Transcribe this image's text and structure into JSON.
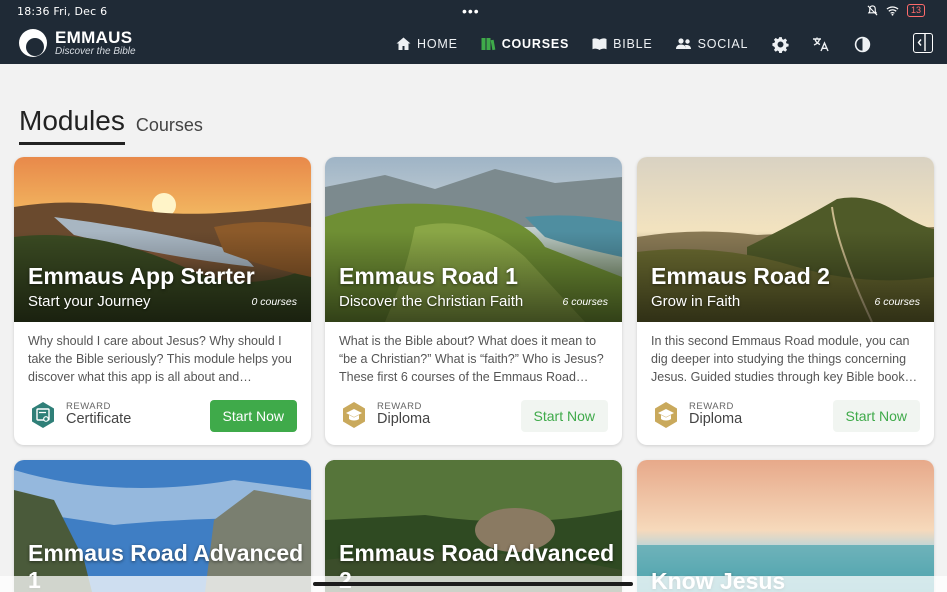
{
  "status": {
    "time": "18:36",
    "date": "Fri, Dec 6",
    "battery": "13"
  },
  "brand": {
    "name": "EMMAUS",
    "tagline": "Discover the Bible"
  },
  "nav": [
    {
      "label": "HOME",
      "icon": "home-icon"
    },
    {
      "label": "COURSES",
      "icon": "courses-icon",
      "active": true
    },
    {
      "label": "BIBLE",
      "icon": "bible-icon"
    },
    {
      "label": "SOCIAL",
      "icon": "social-icon"
    }
  ],
  "nav_icons": [
    "settings-icon",
    "translate-icon",
    "theme-icon",
    "collapse-sidebar-icon"
  ],
  "tabs": {
    "active": "Modules",
    "inactive": "Courses"
  },
  "cards": [
    {
      "title": "Emmaus App Starter",
      "subtitle": "Start your Journey",
      "count": "0 courses",
      "description": "Why should I care about Jesus? Why should I take the Bible seriously? This module helps you discover what this app is all about and…",
      "reward_label": "REWARD",
      "reward": "Certificate",
      "button": "Start Now",
      "button_style": "primary"
    },
    {
      "title": "Emmaus Road 1",
      "subtitle": "Discover the Christian Faith",
      "count": "6 courses",
      "description": "What is the Bible about? What does it mean to “be a Christian?” What is “faith?” Who is Jesus? These first 6 courses of the Emmaus Road…",
      "reward_label": "REWARD",
      "reward": "Diploma",
      "button": "Start Now",
      "button_style": "secondary"
    },
    {
      "title": "Emmaus Road 2",
      "subtitle": "Grow in Faith",
      "count": "6 courses",
      "description": "In this second Emmaus Road module, you can dig deeper into studying the things concerning Jesus. Guided studies through key Bible book…",
      "reward_label": "REWARD",
      "reward": "Diploma",
      "button": "Start Now",
      "button_style": "secondary"
    },
    {
      "title": "Emmaus Road Advanced",
      "title_line2": "1"
    },
    {
      "title": "Emmaus Road Advanced",
      "title_line2": "2"
    },
    {
      "title": "Know Jesus"
    }
  ],
  "colors": {
    "header": "#1f2a36",
    "accent": "#3faa4a",
    "background": "#f2f2f2"
  }
}
